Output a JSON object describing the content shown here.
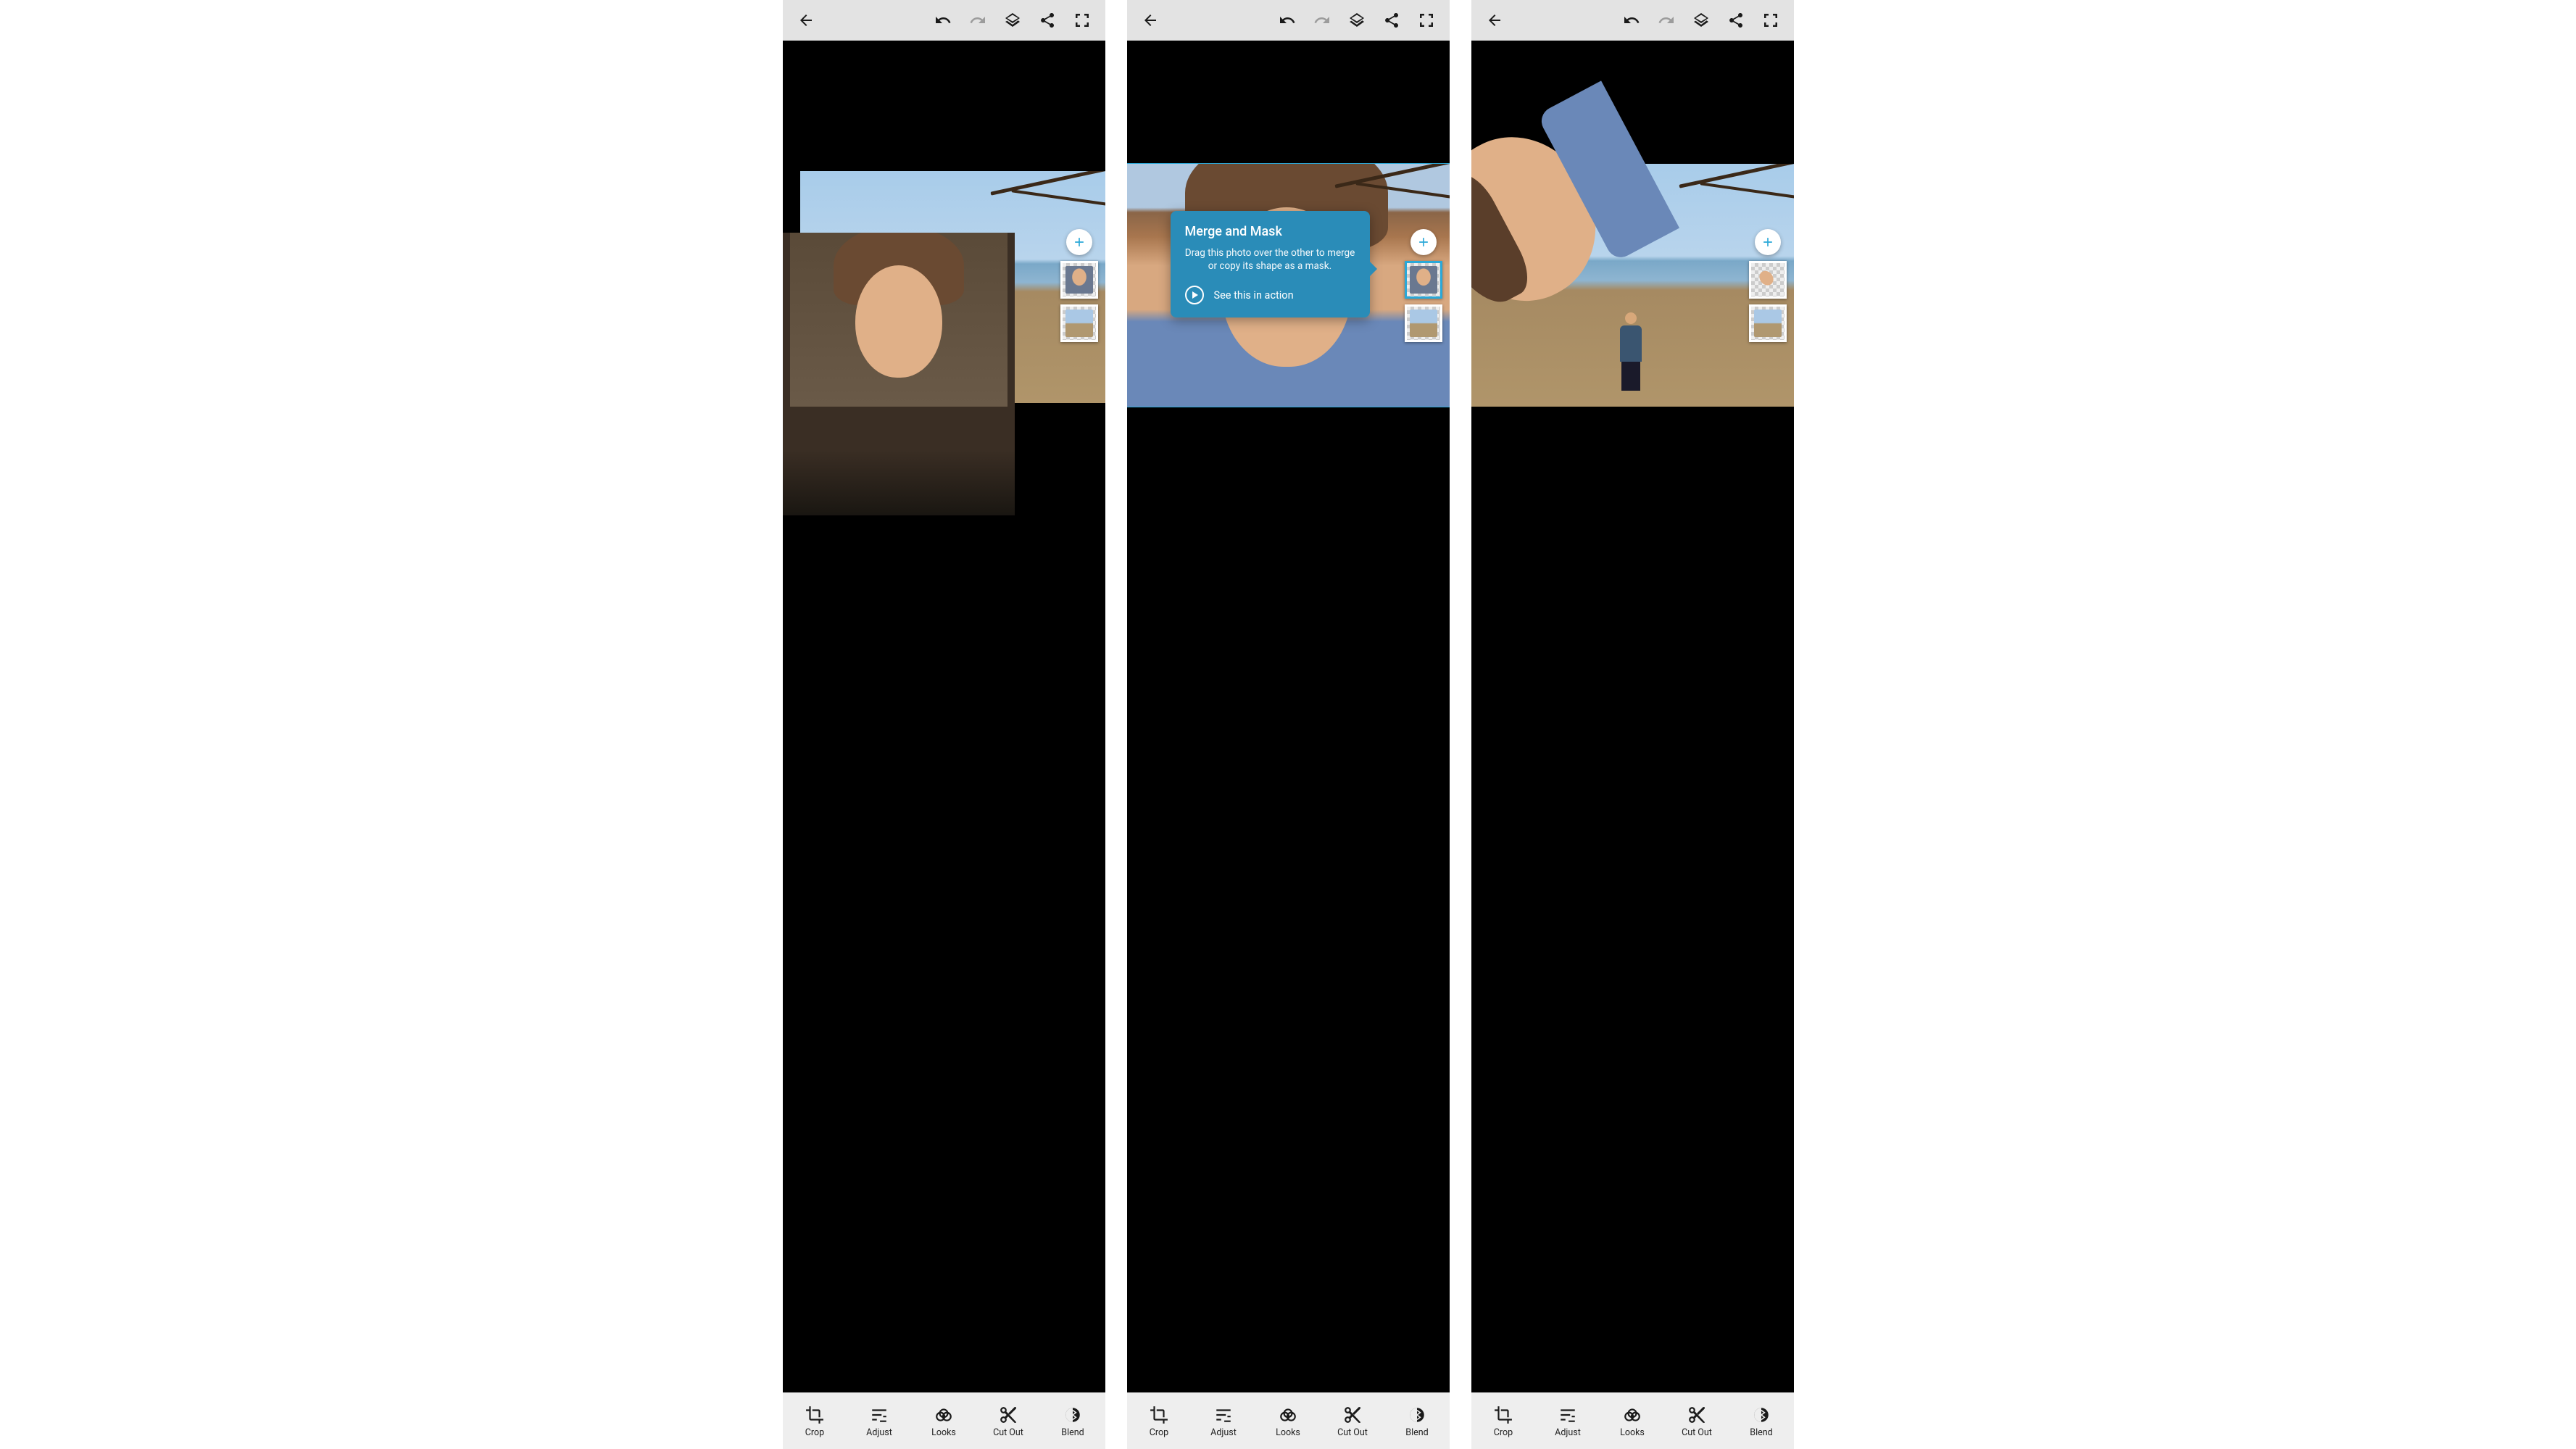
{
  "tooltip": {
    "title": "Merge and Mask",
    "body": "Drag this photo over the other to merge or copy its shape as a mask.",
    "action": "See this in action"
  },
  "tools": {
    "crop": "Crop",
    "adjust": "Adjust",
    "looks": "Looks",
    "cutout": "Cut Out",
    "blend": "Blend"
  },
  "icons": {
    "back": "back",
    "undo": "undo",
    "redo": "redo",
    "layers": "layers",
    "share": "share",
    "fullscreen": "fullscreen",
    "add": "add"
  }
}
